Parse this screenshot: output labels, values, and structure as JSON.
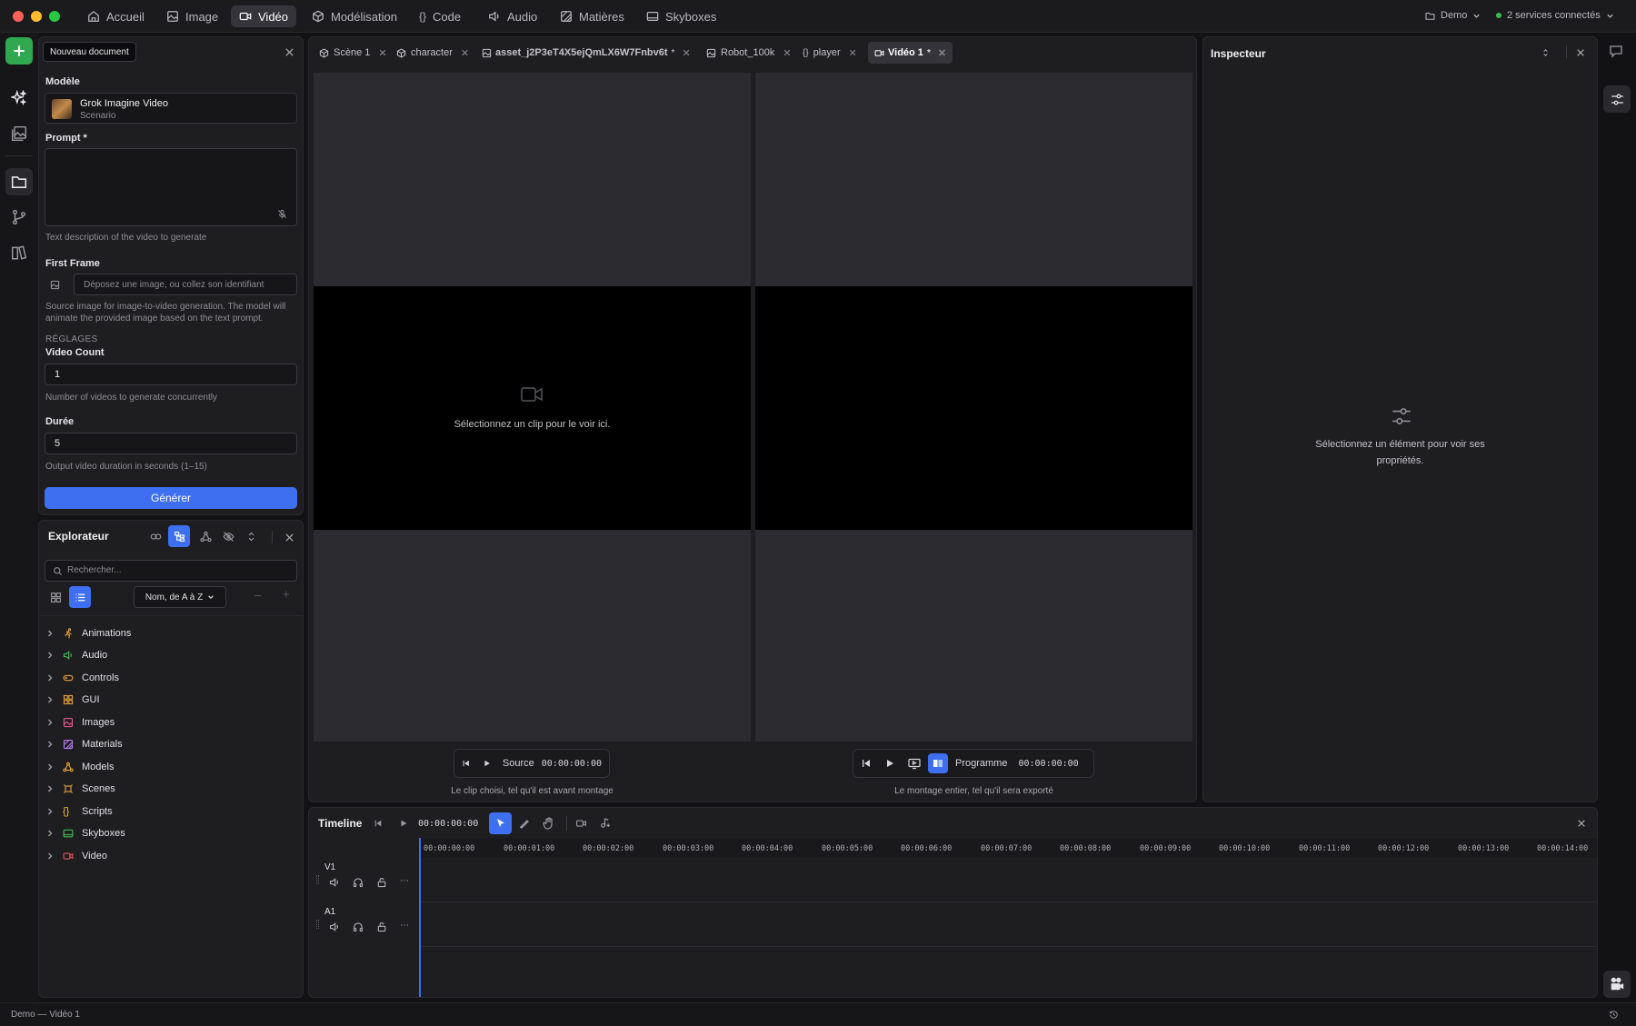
{
  "nav": {
    "tabs": [
      {
        "label": "Accueil",
        "icon": "home-icon"
      },
      {
        "label": "Image",
        "icon": "image-icon"
      },
      {
        "label": "Vidéo",
        "icon": "video-icon"
      },
      {
        "label": "Modélisation",
        "icon": "cube-icon"
      },
      {
        "label": "Code",
        "icon": "braces-icon"
      },
      {
        "label": "Audio",
        "icon": "speaker-icon"
      },
      {
        "label": "Matières",
        "icon": "material-icon"
      },
      {
        "label": "Skyboxes",
        "icon": "skybox-icon"
      }
    ],
    "active_tab": "Vidéo",
    "workspace": "Demo",
    "services": "2 services connectés",
    "services_status_color": "#3fb950"
  },
  "generate_panel": {
    "tooltip": "Nouveau document",
    "model_label": "Modèle",
    "model_name": "Grok Imagine Video",
    "model_sub": "Scenario",
    "prompt_label": "Prompt *",
    "prompt_value": "",
    "prompt_help": "Text description of the video to generate",
    "first_frame_label": "First Frame",
    "first_frame_placeholder": "Déposez une image, ou collez son identifiant",
    "first_frame_help_1": "Source image for image-to-video generation. The model will",
    "first_frame_help_2": "animate the provided image based on the text prompt.",
    "settings_heading": "RÉGLAGES",
    "video_count_label": "Video Count",
    "video_count_value": "1",
    "video_count_help": "Number of videos to generate concurrently",
    "duration_label": "Durée",
    "duration_value": "5",
    "duration_help": "Output video duration in seconds (1–15)",
    "generate_button": "Générer",
    "accent_color": "#3d6ff0"
  },
  "explorer": {
    "title": "Explorateur",
    "search_placeholder": "Rechercher...",
    "sort_label": "Nom, de A à Z",
    "items": [
      {
        "label": "Animations",
        "icon": "running-icon",
        "color": "#e8a23a"
      },
      {
        "label": "Audio",
        "icon": "speaker-icon",
        "color": "#3fb950"
      },
      {
        "label": "Controls",
        "icon": "gamepad-icon",
        "color": "#e8a23a"
      },
      {
        "label": "GUI",
        "icon": "grid-icon",
        "color": "#e8a23a"
      },
      {
        "label": "Images",
        "icon": "image-icon",
        "color": "#e05a8a"
      },
      {
        "label": "Materials",
        "icon": "material-icon",
        "color": "#b57cf0"
      },
      {
        "label": "Models",
        "icon": "models-icon",
        "color": "#e8a23a"
      },
      {
        "label": "Scenes",
        "icon": "scene-icon",
        "color": "#e8a23a"
      },
      {
        "label": "Scripts",
        "icon": "braces-icon",
        "color": "#e8c33a"
      },
      {
        "label": "Skyboxes",
        "icon": "skybox-icon",
        "color": "#3fb950"
      },
      {
        "label": "Video",
        "icon": "video-icon",
        "color": "#e05a5a"
      }
    ]
  },
  "doc_tabs": [
    {
      "label": "Scène 1",
      "icon": "cube-icon",
      "modified": false
    },
    {
      "label": "character",
      "icon": "cube-icon",
      "modified": false
    },
    {
      "label": "asset_j2P3eT4X5ejQmLX6W7Fnbv6t",
      "icon": "image-icon",
      "modified": true
    },
    {
      "label": "Robot_100k",
      "icon": "image-icon",
      "modified": false
    },
    {
      "label": "player",
      "icon": "braces-icon",
      "modified": false
    },
    {
      "label": "Vidéo 1",
      "icon": "video-icon",
      "modified": true
    }
  ],
  "viewers": {
    "source_empty": "Sélectionnez un clip pour le voir ici.",
    "source_label": "Source",
    "source_time": "00:00:00:00",
    "source_caption": "Le clip choisi, tel qu'il est avant montage",
    "program_label": "Programme",
    "program_time": "00:00:00:00",
    "program_caption": "Le montage entier, tel qu'il sera exporté"
  },
  "inspector": {
    "title": "Inspecteur",
    "empty_1": "Sélectionnez un élément pour voir ses",
    "empty_2": "propriétés."
  },
  "timeline": {
    "title": "Timeline",
    "time": "00:00:00:00",
    "ticks": [
      "00:00:00:00",
      "00:00:01:00",
      "00:00:02:00",
      "00:00:03:00",
      "00:00:04:00",
      "00:00:05:00",
      "00:00:06:00",
      "00:00:07:00",
      "00:00:08:00",
      "00:00:09:00",
      "00:00:10:00",
      "00:00:11:00",
      "00:00:12:00",
      "00:00:13:00",
      "00:00:14:00"
    ],
    "tracks": [
      {
        "name": "V1"
      },
      {
        "name": "A1"
      }
    ]
  },
  "status_bar": {
    "text": "Demo — Vidéo 1"
  }
}
